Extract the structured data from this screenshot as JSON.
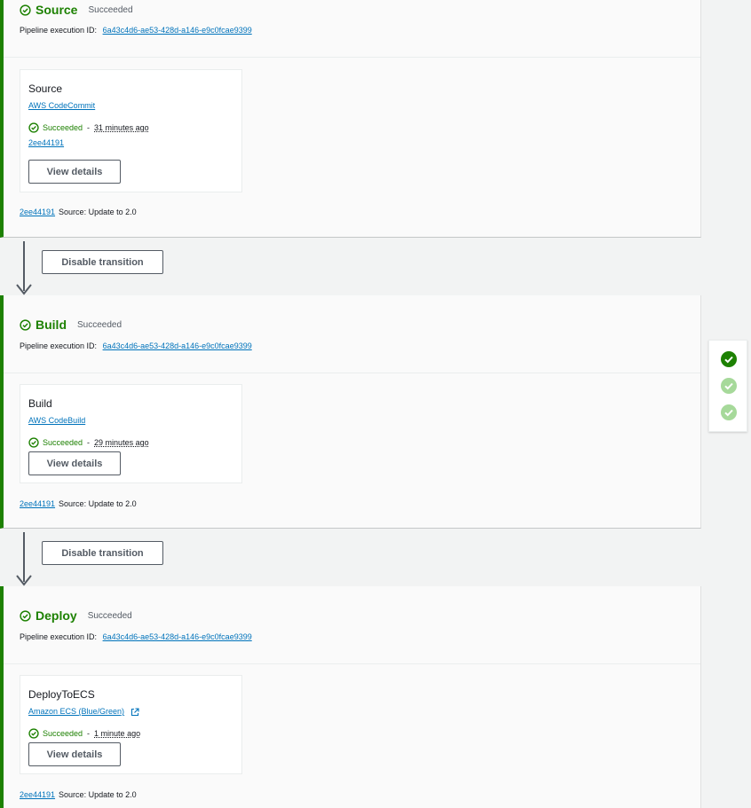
{
  "common": {
    "execution_label": "Pipeline execution ID:",
    "execution_id": "6a43c4d6-ae53-428d-a146-e9c0fcae9399",
    "status_succeeded": "Succeeded",
    "view_details_label": "View details",
    "dash": "-",
    "commit_id": "2ee44191",
    "commit_message": "Source: Update to 2.0",
    "disable_transition_label": "Disable transition"
  },
  "stages": [
    {
      "name": "Source",
      "status": "Succeeded",
      "action": {
        "name": "Source",
        "provider": "AWS CodeCommit",
        "status": "Succeeded",
        "time": "31 minutes ago",
        "revision": "2ee44191"
      }
    },
    {
      "name": "Build",
      "status": "Succeeded",
      "action": {
        "name": "Build",
        "provider": "AWS CodeBuild",
        "status": "Succeeded",
        "time": "29 minutes ago"
      }
    },
    {
      "name": "Deploy",
      "status": "Succeeded",
      "action": {
        "name": "DeployToECS",
        "provider": "Amazon ECS (Blue/Green)",
        "status": "Succeeded",
        "time": "1 minute ago"
      }
    }
  ],
  "colors": {
    "success": "#1d8102",
    "link": "#0073bb",
    "minimap_active": "#1d8102",
    "minimap_inactive": "#a6d99a"
  },
  "icons": {
    "status": "check-circle-icon",
    "external": "external-link-icon",
    "transition": "arrow-down-icon"
  }
}
